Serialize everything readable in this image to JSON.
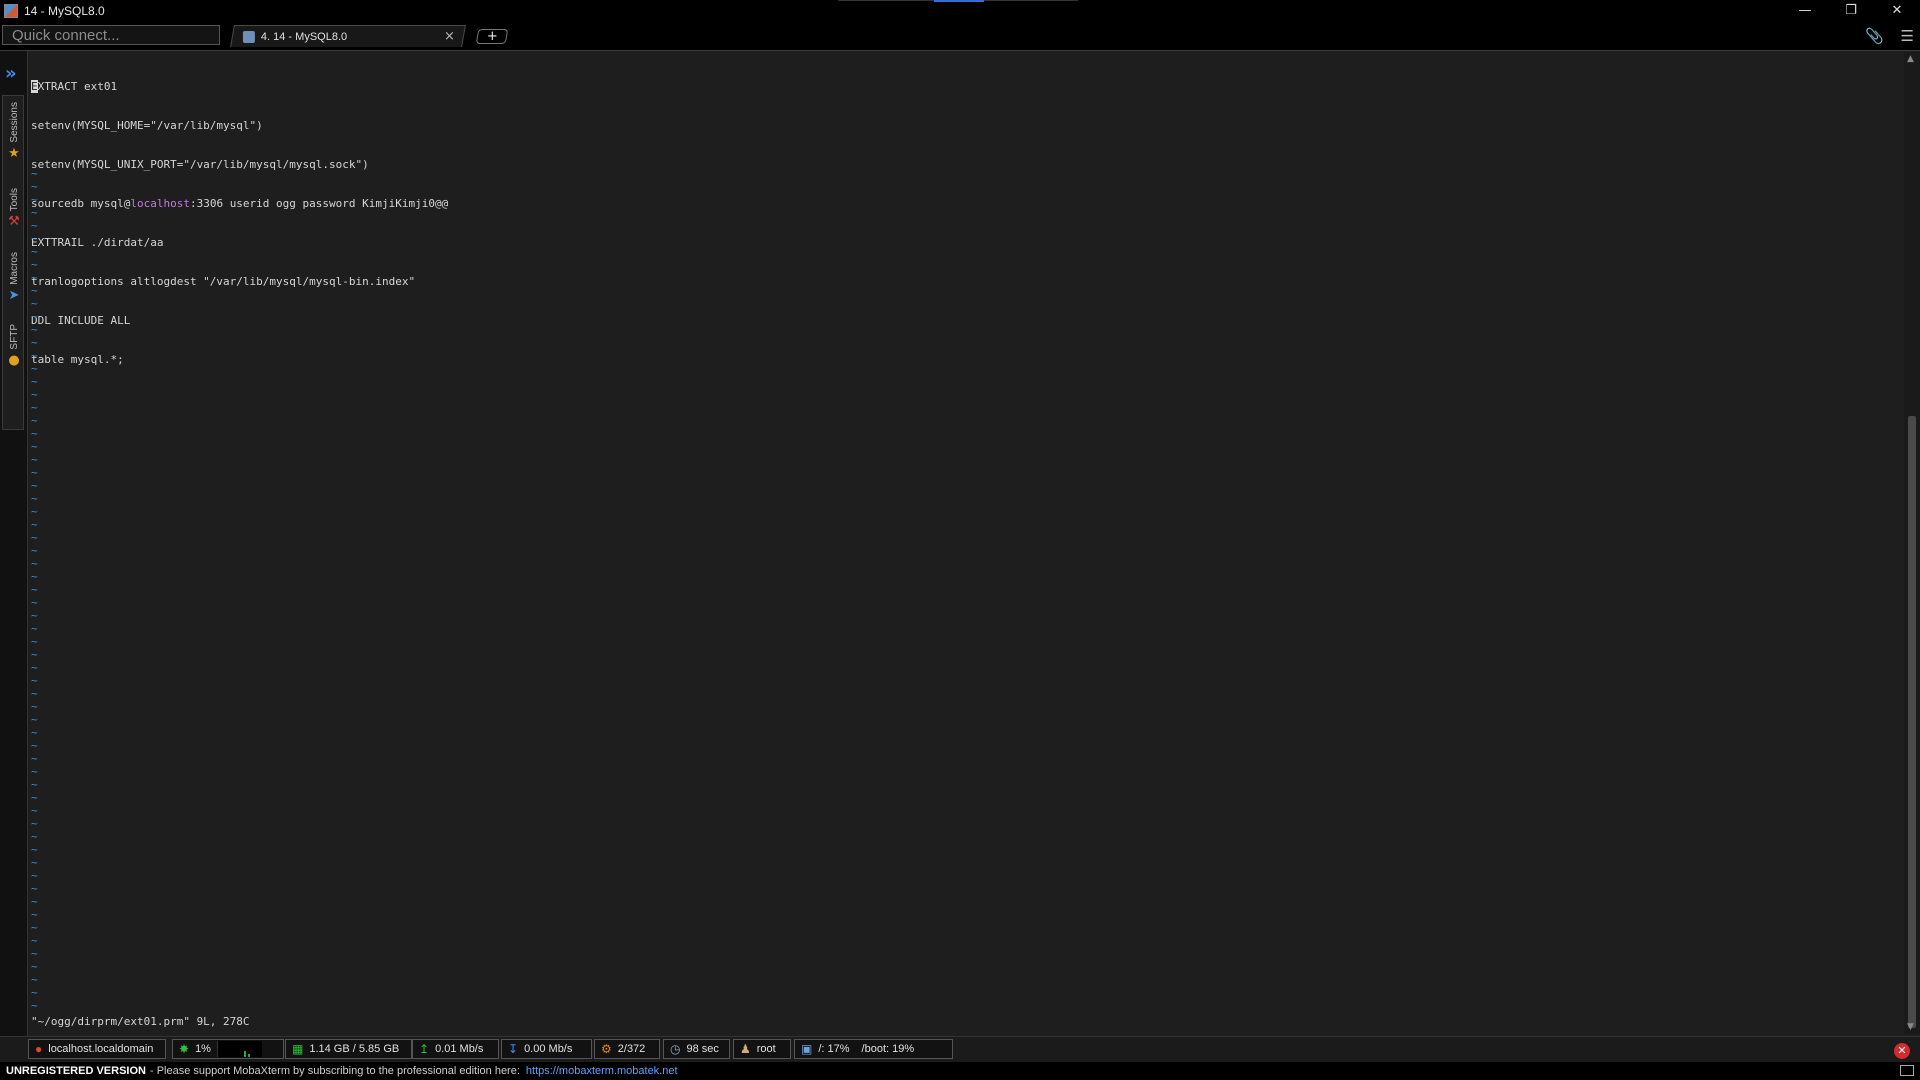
{
  "window": {
    "title": "14 - MySQL8.0",
    "controls": [
      "minimize",
      "restore",
      "close"
    ]
  },
  "tabbar": {
    "quick_connect_placeholder": "Quick connect...",
    "tab": {
      "label": "4. 14 - MySQL8.0",
      "close": "×"
    },
    "new_tab": "+"
  },
  "sidebar": {
    "tabs": [
      {
        "label": "Sessions",
        "icon": "star-icon"
      },
      {
        "label": "Tools",
        "icon": "tools-icon"
      },
      {
        "label": "Macros",
        "icon": "send-icon"
      },
      {
        "label": "SFTP",
        "icon": "globe-icon"
      }
    ]
  },
  "terminal": {
    "lines": {
      "l1_cursor": "E",
      "l1_rest": "XTRACT ext01",
      "l2": "setenv(MYSQL_HOME=\"/var/lib/mysql\")",
      "l3": "setenv(MYSQL_UNIX_PORT=\"/var/lib/mysql/mysql.sock\")",
      "l4_a": "sourcedb mysql@",
      "l4_host": "localhost",
      "l4_b": ":3306 userid ogg password KimjiKimji0@@",
      "l5": "EXTTRAIL ./dirdat/aa",
      "l6": "tranlogoptions altlogdest \"/var/lib/mysql/mysql-bin.index\"",
      "l7": "DDL INCLUDE ALL",
      "l8": "table mysql.*;"
    },
    "empty_line_marker": "~",
    "vim_status": "\"~/ogg/dirprm/ext01.prm\" 9L, 278C"
  },
  "statusbar": {
    "host": "localhost.localdomain",
    "cpu": "1%",
    "memory": "1.14 GB / 5.85 GB",
    "upload": "0.01 Mb/s",
    "download": "0.00 Mb/s",
    "processes": "2/372",
    "uptime": "98 sec",
    "user": "root",
    "disk_root": "/: 17%",
    "disk_boot": "/boot: 19%"
  },
  "footer": {
    "edition": "UNREGISTERED VERSION",
    "message": " -  Please support MobaXterm by subscribing to the professional edition here:",
    "link": "https://mobaxterm.mobatek.net"
  },
  "colors": {
    "terminal_bg": "#1e1e1e",
    "tilde": "#3a8fd0",
    "highlight": "#c678dd",
    "accent": "#2f6fd6"
  }
}
